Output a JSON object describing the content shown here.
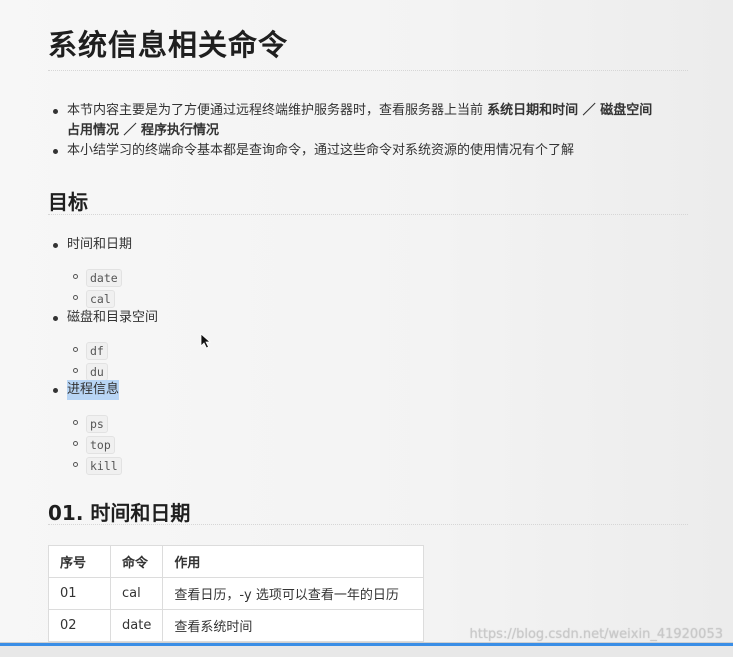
{
  "title": "系统信息相关命令",
  "intro": {
    "line1_pre": "本节内容主要是为了方便通过远程终端维护服务器时，查看服务器上当前",
    "line1_bold": "系统日期和时间 ／ 磁盘空间",
    "line2_bold": "占用情况 ／ 程序执行情况",
    "line3": "本小结学习的终端命令基本都是查询命令，通过这些命令对系统资源的使用情况有个了解"
  },
  "goals": {
    "heading": "目标",
    "groups": [
      {
        "label": "时间和日期",
        "commands": [
          "date",
          "cal"
        ]
      },
      {
        "label": "磁盘和目录空间",
        "commands": [
          "df",
          "du"
        ]
      },
      {
        "label": "进程信息",
        "commands": [
          "ps",
          "top",
          "kill"
        ]
      }
    ]
  },
  "section1": {
    "heading": "01. 时间和日期",
    "table": {
      "headers": [
        "序号",
        "命令",
        "作用"
      ],
      "rows": [
        [
          "01",
          "cal",
          "查看日历，-y 选项可以查看一年的日历"
        ],
        [
          "02",
          "date",
          "查看系统时间"
        ]
      ]
    }
  },
  "watermark": "https://blog.csdn.net/weixin_41920053",
  "colors": {
    "selection": "#b8d5f5",
    "progress": "#3a8ee6"
  }
}
